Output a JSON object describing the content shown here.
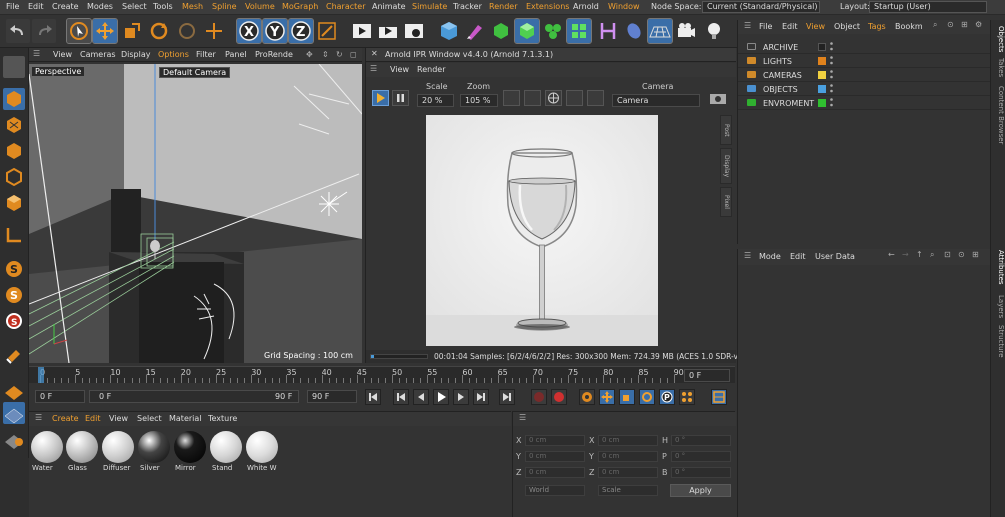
{
  "menu": [
    "File",
    "Edit",
    "Create",
    "Modes",
    "Select",
    "Tools",
    "Mesh",
    "Spline",
    "Volume",
    "MoGraph",
    "Character",
    "Animate",
    "Simulate",
    "Tracker",
    "Render",
    "Extensions",
    "Arnold",
    "Window"
  ],
  "node_space": {
    "label": "Node Space:",
    "value": "Current (Standard/Physical)"
  },
  "layout": {
    "label": "Layout:",
    "value": "Startup (User)"
  },
  "viewport": {
    "menu": [
      "View",
      "Cameras",
      "Display",
      "Options",
      "Filter",
      "Panel",
      "ProRende"
    ],
    "label": "Perspective",
    "camera": "Default Camera",
    "grid_spacing": "Grid Spacing : 100 cm"
  },
  "ipr": {
    "title": "Arnold IPR Window v4.4.0 (Arnold 7.1.3.1)",
    "menu": [
      "View",
      "Render"
    ],
    "scale_label": "Scale",
    "scale_value": "20 %",
    "zoom_label": "Zoom",
    "zoom_value": "105 %",
    "camera_label": "Camera",
    "camera_value": "Camera",
    "side_tabs": [
      "Post",
      "Display",
      "Pixel"
    ],
    "status": "00:01:04  Samples: [6/2/4/6/2/2]  Res: 300x300  Mem: 724.39 MB  (ACES 1.0 SDR-vid"
  },
  "object_manager": {
    "menu": [
      "File",
      "Edit",
      "View",
      "Object",
      "Tags",
      "Bookm"
    ],
    "objects": [
      {
        "name": "ARCHIVE",
        "color": "#222222",
        "folder": "#d08a2a"
      },
      {
        "name": "LIGHTS",
        "color": "#e0821c",
        "folder": "#d08a2a"
      },
      {
        "name": "CAMERAS",
        "color": "#f0d040",
        "folder": "#d08a2a"
      },
      {
        "name": "OBJECTS",
        "color": "#4aa0e0",
        "folder": "#4a90d0"
      },
      {
        "name": "ENVROMENT",
        "color": "#30c030",
        "folder": "#30b030"
      }
    ]
  },
  "right_tabs_top": [
    "Objects",
    "Takes",
    "Content Browser"
  ],
  "right_tabs_bottom": [
    "Attributes",
    "Layers",
    "Structure"
  ],
  "attributes": {
    "menu": [
      "Mode",
      "Edit",
      "User Data"
    ]
  },
  "timeline": {
    "ticks": [
      "0",
      "5",
      "10",
      "15",
      "20",
      "25",
      "30",
      "35",
      "40",
      "45",
      "50",
      "55",
      "60",
      "65",
      "70",
      "75",
      "80",
      "85",
      "90"
    ],
    "current_frame": "0 F"
  },
  "transport": {
    "start": "0 F",
    "range_start": "0 F",
    "range_end": "90 F",
    "end": "90 F"
  },
  "material_manager": {
    "menu": [
      "Create",
      "Edit",
      "View",
      "Select",
      "Material",
      "Texture"
    ],
    "materials": [
      "Water",
      "Glass",
      "Diffuser",
      "Silver",
      "Mirror",
      "Stand",
      "White W"
    ]
  },
  "coordinates": {
    "rows": [
      {
        "a": "X",
        "av": "0 cm",
        "b": "X",
        "bv": "0 cm",
        "c": "H",
        "cv": "0 °"
      },
      {
        "a": "Y",
        "av": "0 cm",
        "b": "Y",
        "bv": "0 cm",
        "c": "P",
        "cv": "0 °"
      },
      {
        "a": "Z",
        "av": "0 cm",
        "b": "Z",
        "bv": "0 cm",
        "c": "B",
        "cv": "0 °"
      }
    ],
    "mode1": "World",
    "mode2": "Scale",
    "apply": "Apply"
  }
}
